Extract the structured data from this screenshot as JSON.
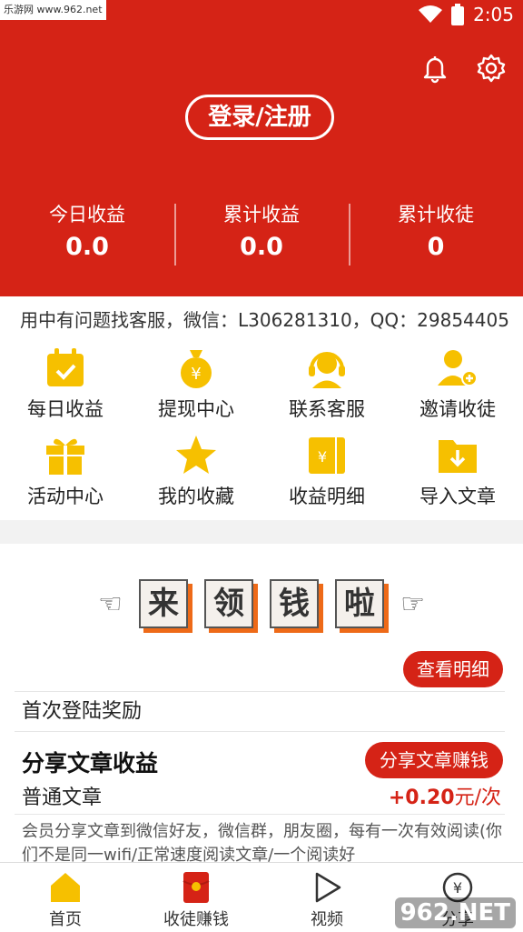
{
  "status_bar": {
    "watermark": "乐游网 www.962.net",
    "time": "2:05"
  },
  "header": {
    "login_label": "登录/注册",
    "bell_icon": "bell-icon",
    "settings_icon": "gear-icon"
  },
  "stats": [
    {
      "label": "今日收益",
      "value": "0.0"
    },
    {
      "label": "累计收益",
      "value": "0.0"
    },
    {
      "label": "累计收徒",
      "value": "0"
    }
  ],
  "notice": {
    "text": "用中有问题找客服，微信：L306281310，QQ：29854405"
  },
  "grid": [
    {
      "label": "每日收益",
      "icon": "calendar-check-icon"
    },
    {
      "label": "提现中心",
      "icon": "money-bag-icon"
    },
    {
      "label": "联系客服",
      "icon": "headset-icon"
    },
    {
      "label": "邀请收徒",
      "icon": "add-user-icon"
    },
    {
      "label": "活动中心",
      "icon": "gift-icon"
    },
    {
      "label": "我的收藏",
      "icon": "star-icon"
    },
    {
      "label": "收益明细",
      "icon": "wallet-icon"
    },
    {
      "label": "导入文章",
      "icon": "folder-download-icon"
    }
  ],
  "promo": {
    "banner_chars": [
      "来",
      "领",
      "钱",
      "啦"
    ],
    "detail_button": "查看明细",
    "first_login": "首次登陆奖励",
    "share_title": "分享文章收益",
    "share_button": "分享文章赚钱",
    "normal_article": "普通文章",
    "rate_value": "+0.20",
    "rate_unit": "元/次",
    "description": "会员分享文章到微信好友，微信群，朋友圈，每有一次有效阅读(你们不是同一wifi/正常速度阅读文章/一个阅读好"
  },
  "tabs": [
    {
      "label": "首页",
      "icon": "home-icon"
    },
    {
      "label": "收徒赚钱",
      "icon": "red-envelope-icon"
    },
    {
      "label": "视频",
      "icon": "play-icon"
    },
    {
      "label": "分享",
      "icon": "yen-coin-icon"
    }
  ],
  "bottom_watermark": "962.NET",
  "colors": {
    "brand_red": "#d52316",
    "icon_yellow": "#f6c000",
    "accent_orange": "#ee6a18"
  }
}
